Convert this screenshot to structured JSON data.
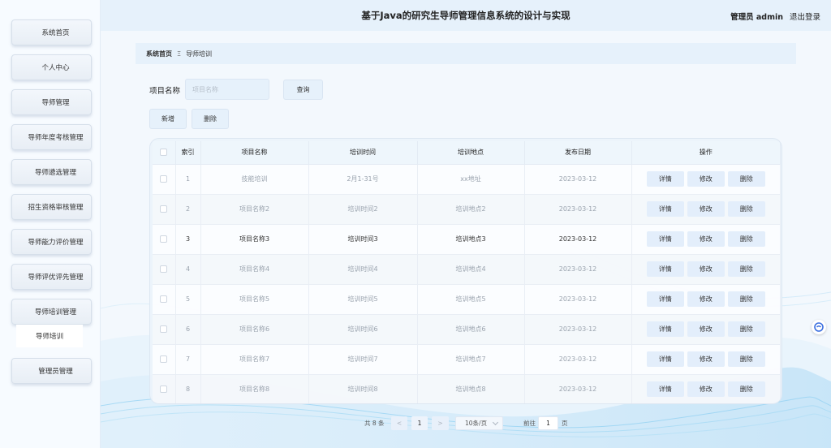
{
  "header": {
    "title": "基于Java的研究生导师管理信息系统的设计与实现",
    "user": "管理员 admin",
    "logout": "退出登录"
  },
  "sidebar": {
    "items": [
      {
        "label": "系统首页"
      },
      {
        "label": "个人中心"
      },
      {
        "label": "导师管理"
      },
      {
        "label": "导师年度考核管理"
      },
      {
        "label": "导师遴选管理"
      },
      {
        "label": "招生资格审核管理"
      },
      {
        "label": "导师能力评价管理"
      },
      {
        "label": "导师评优评先管理"
      },
      {
        "label": "导师培训管理"
      },
      {
        "label": "管理员管理"
      }
    ],
    "sub_item": "导师培训"
  },
  "breadcrumb": {
    "home": "系统首页",
    "separator": "Ξ",
    "current": "导师培训"
  },
  "search": {
    "label": "项目名称",
    "placeholder": "项目名称",
    "query_button": "查询"
  },
  "actions": {
    "add": "新增",
    "delete": "删除"
  },
  "table": {
    "columns": [
      "索引",
      "项目名称",
      "培训时间",
      "培训地点",
      "发布日期",
      "操作"
    ],
    "rows": [
      {
        "index": "1",
        "name": "技能培训",
        "time": "2月1-31号",
        "place": "xx地址",
        "date": "2023-03-12"
      },
      {
        "index": "2",
        "name": "项目名称2",
        "time": "培训时间2",
        "place": "培训地点2",
        "date": "2023-03-12"
      },
      {
        "index": "3",
        "name": "项目名称3",
        "time": "培训时间3",
        "place": "培训地点3",
        "date": "2023-03-12"
      },
      {
        "index": "4",
        "name": "项目名称4",
        "time": "培训时间4",
        "place": "培训地点4",
        "date": "2023-03-12"
      },
      {
        "index": "5",
        "name": "项目名称5",
        "time": "培训时间5",
        "place": "培训地点5",
        "date": "2023-03-12"
      },
      {
        "index": "6",
        "name": "项目名称6",
        "time": "培训时间6",
        "place": "培训地点6",
        "date": "2023-03-12"
      },
      {
        "index": "7",
        "name": "项目名称7",
        "time": "培训时间7",
        "place": "培训地点7",
        "date": "2023-03-12"
      },
      {
        "index": "8",
        "name": "项目名称8",
        "time": "培训时间8",
        "place": "培训地点8",
        "date": "2023-03-12"
      }
    ],
    "row_actions": {
      "detail": "详情",
      "edit": "修改",
      "delete": "删除"
    }
  },
  "pagination": {
    "total": "共 8 条",
    "prev": "<",
    "current_page": "1",
    "next": ">",
    "page_size": "10条/页",
    "goto_label": "前往",
    "goto_value": "1",
    "page_suffix": "页"
  },
  "colors": {
    "accent": "#e6f1fb",
    "sidebar_bg": "#f7fbff",
    "page_bg": "#f3f8fd"
  }
}
